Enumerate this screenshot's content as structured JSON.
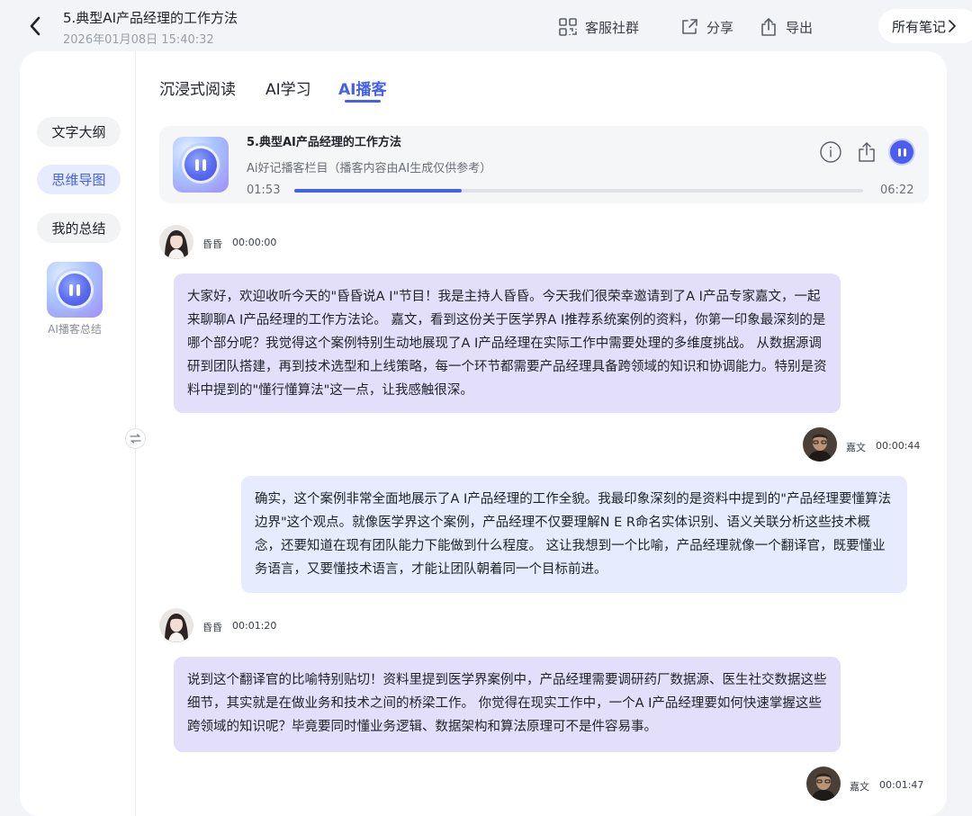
{
  "header": {
    "title": "5.典型AI产品经理的工作方法",
    "date": "2026年01月08日 15:40:32",
    "tools": {
      "service": "客服社群",
      "share": "分享",
      "export": "导出"
    },
    "notes_button": "所有笔记"
  },
  "sidebar": {
    "items": [
      {
        "label": "文字大纲"
      },
      {
        "label": "思维导图"
      },
      {
        "label": "我的总结"
      }
    ],
    "podcast_label": "AI播客总结"
  },
  "tabs": [
    {
      "label": "沉浸式阅读"
    },
    {
      "label": "AI学习"
    },
    {
      "label": "AI播客"
    }
  ],
  "player": {
    "title": "5.典型AI产品经理的工作方法",
    "subtitle": "Ai好记播客栏目（播客内容由AI生成仅供参考）",
    "current_time": "01:53",
    "total_time": "06:22",
    "progress": 0.295
  },
  "chat": [
    {
      "speaker": "昏昏",
      "time": "00:00:00",
      "text": "大家好，欢迎收听今天的\"昏昏说A I\"节目！我是主持人昏昏。今天我们很荣幸邀请到了A I产品专家嘉文，一起来聊聊A I产品经理的工作方法论。 嘉文，看到这份关于医学界A I推荐系统案例的资料，你第一印象最深刻的是哪个部分呢？我觉得这个案例特别生动地展现了A I产品经理在实际工作中需要处理的多维度挑战。 从数据源调研到团队搭建，再到技术选型和上线策略，每一个环节都需要产品经理具备跨领域的知识和协调能力。特别是资料中提到的\"懂行懂算法\"这一点，让我感触很深。"
    },
    {
      "speaker": "嘉文",
      "time": "00:00:44",
      "text": "确实，这个案例非常全面地展示了A I产品经理的工作全貌。我最印象深刻的是资料中提到的\"产品经理要懂算法边界\"这个观点。就像医学界这个案例，产品经理不仅要理解N E R命名实体识别、语义关联分析这些技术概念，还要知道在现有团队能力下能做到什么程度。 这让我想到一个比喻，产品经理就像一个翻译官，既要懂业务语言，又要懂技术语言，才能让团队朝着同一个目标前进。"
    },
    {
      "speaker": "昏昏",
      "time": "00:01:20",
      "text": "说到这个翻译官的比喻特别贴切！资料里提到医学界案例中，产品经理需要调研药厂数据源、医生社交数据这些细节，其实就是在做业务和技术之间的桥梁工作。 你觉得在现实工作中，一个A I产品经理要如何快速掌握这些跨领域的知识呢？毕竟要同时懂业务逻辑、数据架构和算法原理可不是件容易事。"
    },
    {
      "speaker": "嘉文",
      "time": "00:01:47",
      "text": ""
    }
  ]
}
